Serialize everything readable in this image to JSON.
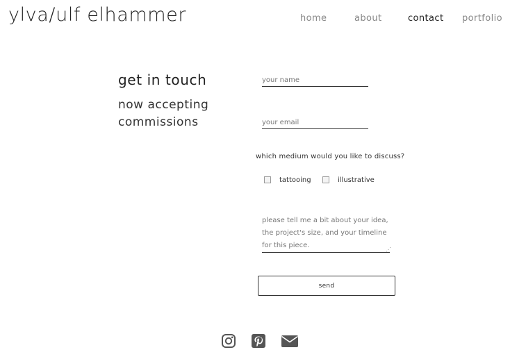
{
  "site": {
    "brand": "ylva/ulf elhammer"
  },
  "nav": {
    "items": [
      {
        "label": "home",
        "active": false
      },
      {
        "label": "about",
        "active": false
      },
      {
        "label": "contact",
        "active": true
      },
      {
        "label": "portfolio",
        "active": false
      }
    ]
  },
  "contact": {
    "heading": "get in touch",
    "subheading": "now accepting commissions",
    "form": {
      "name_placeholder": "your name",
      "email_placeholder": "your email",
      "medium_question": "which medium would you like to discuss?",
      "options": [
        {
          "label": "tattooing",
          "checked": false
        },
        {
          "label": "illustrative",
          "checked": false
        }
      ],
      "message_placeholder": "please tell me a bit about your idea, the project's size, and your timeline for this piece.",
      "submit_label": "send"
    }
  },
  "social": {
    "icons": [
      "instagram-icon",
      "pinterest-icon",
      "email-icon"
    ],
    "icon_color": "#555555"
  }
}
